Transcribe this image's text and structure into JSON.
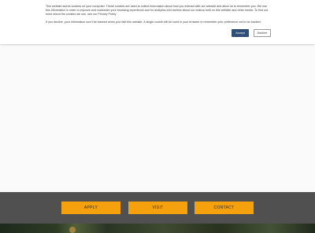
{
  "cookie_banner": {
    "text_primary": "This website stores cookies on your computer. These cookies are used to collect information about how you interact with our website and allow us to remember you. We use this information in order to improve and customize your browsing experience and for analytics and metrics about our visitors both on this website and other media. To find out more about the cookies we use, see our Privacy Policy.",
    "text_secondary": "If you decline, your information won't be tracked when you visit this website. A single cookie will be used in your browser to remember your preference not to be tracked.",
    "accept_label": "Accept",
    "decline_label": "Decline",
    "accent_color": "#2f4f78"
  },
  "cta": {
    "apply_label": "APPLY",
    "visit_label": "VISIT",
    "contact_label": "CONTACT",
    "button_color": "#f5a10e",
    "band_color": "#505050"
  }
}
